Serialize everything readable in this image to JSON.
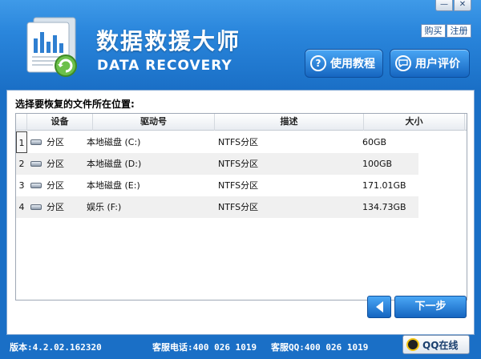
{
  "window": {
    "minimize_label": "—",
    "close_label": "✕",
    "buy_label": "购买",
    "register_label": "注册"
  },
  "header": {
    "title": "数据救援大师",
    "subtitle": "DATA RECOVERY",
    "tutorial_label": "使用教程",
    "review_label": "用户评价",
    "tutorial_icon": "question-icon",
    "review_icon": "chat-bubble-icon"
  },
  "main": {
    "prompt": "选择要恢复的文件所在位置:",
    "columns": [
      "设备",
      "驱动号",
      "描述",
      "大小"
    ],
    "rows": [
      {
        "num": "1",
        "device": "分区",
        "drive": "本地磁盘 (C:)",
        "desc": "NTFS分区",
        "size": "60GB"
      },
      {
        "num": "2",
        "device": "分区",
        "drive": "本地磁盘 (D:)",
        "desc": "NTFS分区",
        "size": "100GB"
      },
      {
        "num": "3",
        "device": "分区",
        "drive": "本地磁盘 (E:)",
        "desc": "NTFS分区",
        "size": "171.01GB"
      },
      {
        "num": "4",
        "device": "分区",
        "drive": "娱乐 (F:)",
        "desc": "NTFS分区",
        "size": "134.73GB"
      }
    ]
  },
  "nav": {
    "next_label": "下一步"
  },
  "status": {
    "version": "版本:4.2.02.162320",
    "phone": "客服电话:400 026 1019",
    "qq": "客服QQ:400 026 1019",
    "qq_button": "QQ在线"
  },
  "colors": {
    "accent": "#1a6fc6",
    "button": "#1565c0"
  }
}
